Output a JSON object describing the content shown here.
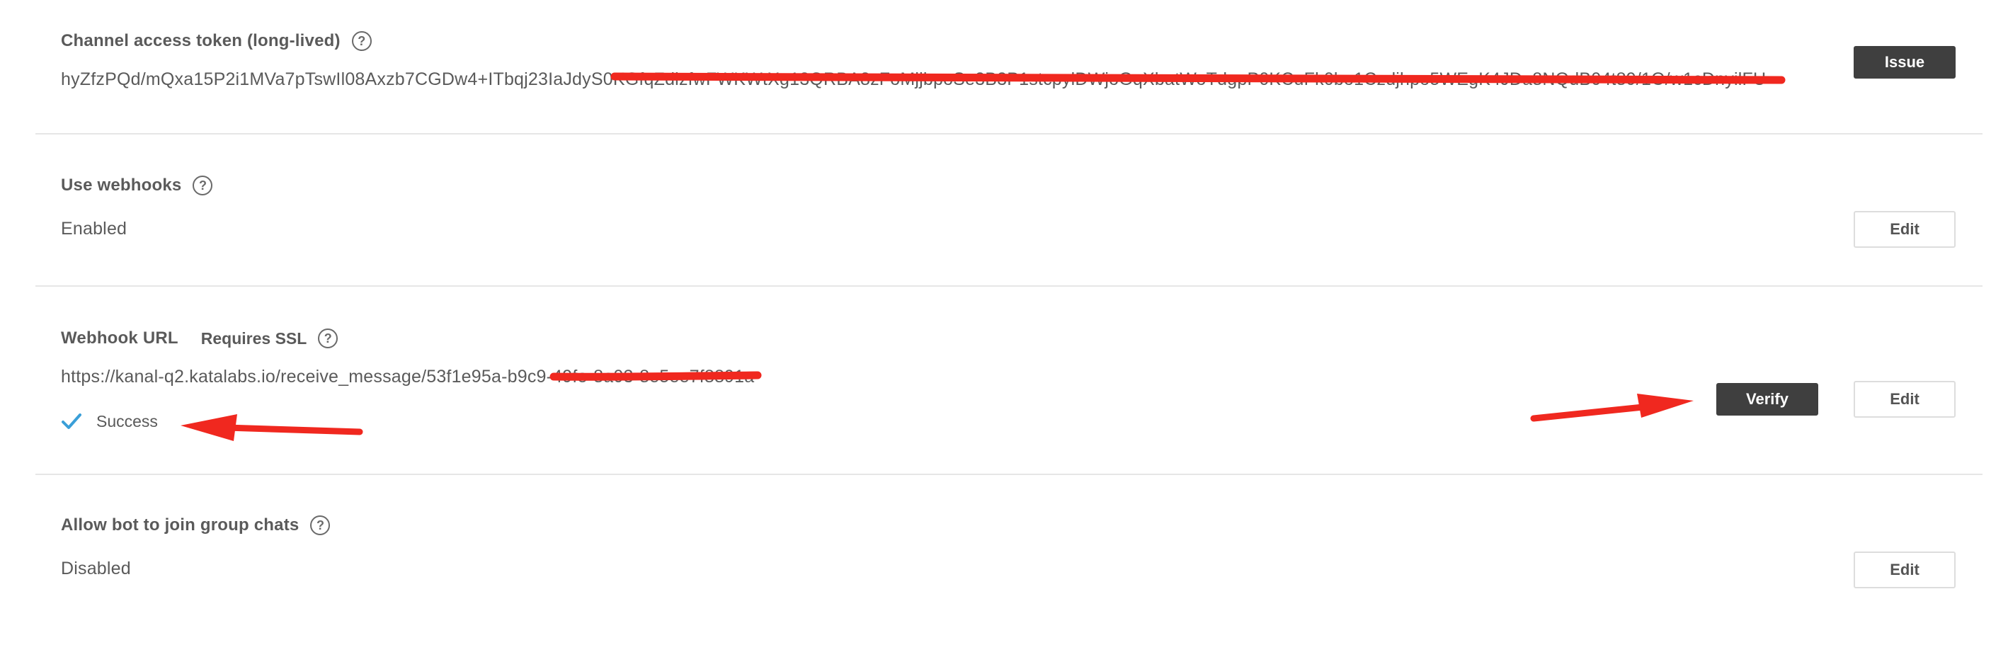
{
  "token_section": {
    "title": "Channel access token (long-lived)",
    "help_glyph": "?",
    "value": "hyZfzPQd/mQxa15P2i1MVa7pTswIl08Axzb7CGDw4+ITbqj23IaJdyS0KGfqZdlzfwFWKWtXg13QRBA8zFoMjjbpoSe3B3P1stcpylDWjoGqXbatWoTdgpP0KCuFk0bo1Czdjhpo5WEgK4JDa8NQdB04t89/1O/w1cDnyilFU=",
    "button_label": "Issue"
  },
  "webhooks_section": {
    "title": "Use webhooks",
    "help_glyph": "?",
    "value": "Enabled",
    "button_label": "Edit"
  },
  "webhook_url_section": {
    "title": "Webhook URL",
    "subtitle": "Requires SSL",
    "help_glyph": "?",
    "value": "https://kanal-q2.katalabs.io/receive_message/53f1e95a-b9c9-49fe-8a03-8e5ee7f8891a",
    "status_icon": "check-icon",
    "status_text": "Success",
    "verify_label": "Verify",
    "edit_label": "Edit"
  },
  "group_chats_section": {
    "title": "Allow bot to join group chats",
    "help_glyph": "?",
    "value": "Disabled",
    "button_label": "Edit"
  },
  "colors": {
    "annotation_red": "#f0281f",
    "success_blue": "#3a9fd8",
    "dark_button": "#3f3f3f",
    "divider": "#e6e6e6",
    "text": "#5a5a5a"
  }
}
